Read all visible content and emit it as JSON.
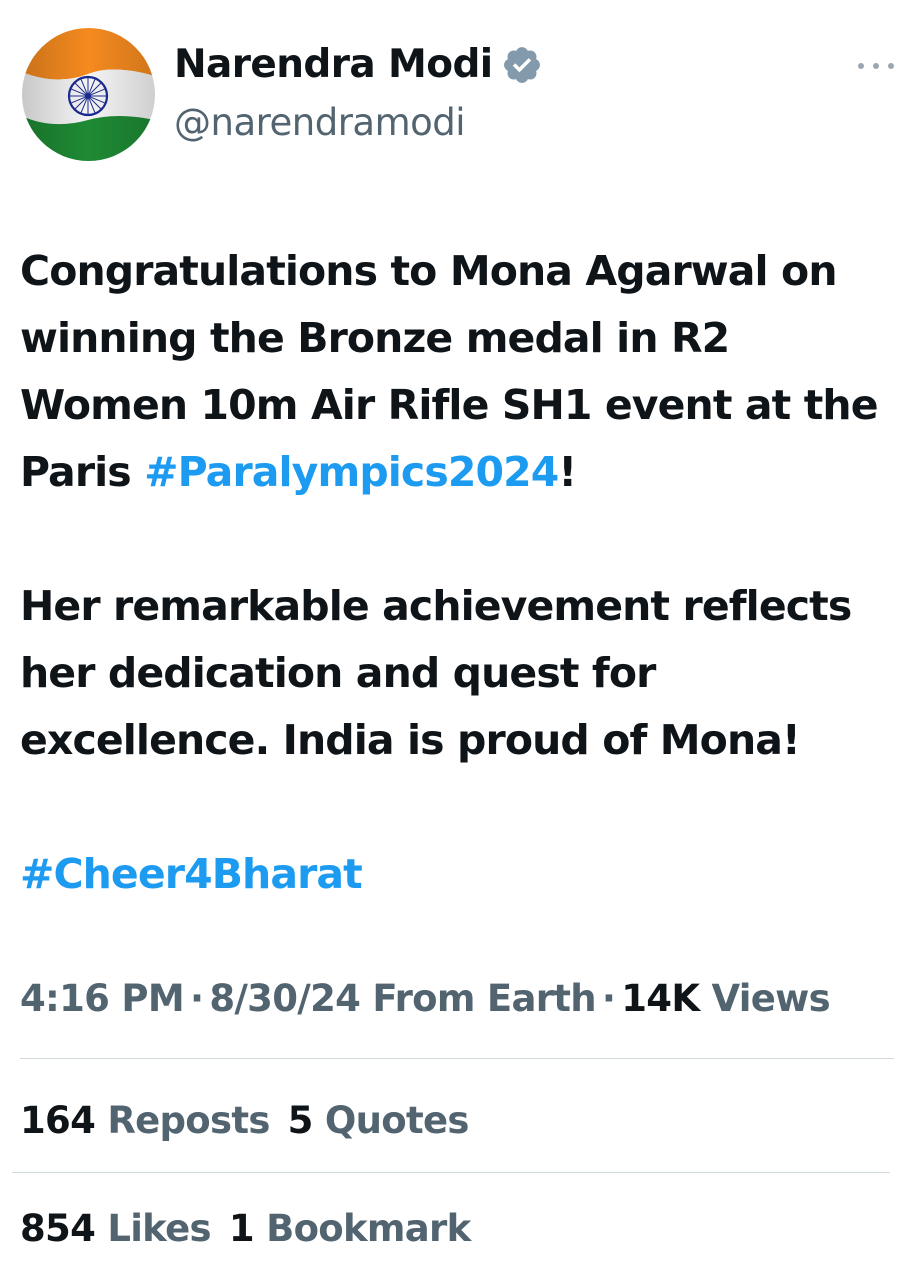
{
  "author": {
    "name": "Narendra Modi",
    "handle": "@narendramodi",
    "verified": true,
    "avatar": "india-flag-avatar",
    "colors": {
      "saffron": "#f58a1f",
      "white": "#ffffff",
      "green": "#1e8a34",
      "chakra": "#1b2a8f"
    }
  },
  "more_icon": "more-horizontal-icon",
  "tweet": {
    "p1_text": "Congratulations to Mona Agarwal on winning the Bronze medal in R2 Women 10m Air Rifle SH1 event at the Paris ",
    "p1_hashtag": "#Paralympics2024",
    "p1_end": "!",
    "p2": "Her remarkable achievement reflects her dedication and quest for excellence. India is proud of Mona!",
    "p3_hashtag": "#Cheer4Bharat"
  },
  "meta": {
    "time": "4:16 PM",
    "date": "8/30/24",
    "source": "From Earth",
    "views_count": "14K",
    "views_label": "Views"
  },
  "stats": {
    "reposts_count": "164",
    "reposts_label": "Reposts",
    "quotes_count": "5",
    "quotes_label": "Quotes",
    "likes_count": "854",
    "likes_label": "Likes",
    "bookmarks_count": "1",
    "bookmarks_label": "Bookmark"
  },
  "colors": {
    "text": "#0f1419",
    "secondary": "#536471",
    "link": "#1d9bf0",
    "verified": "#829aab",
    "divider": "#cfd9de"
  }
}
